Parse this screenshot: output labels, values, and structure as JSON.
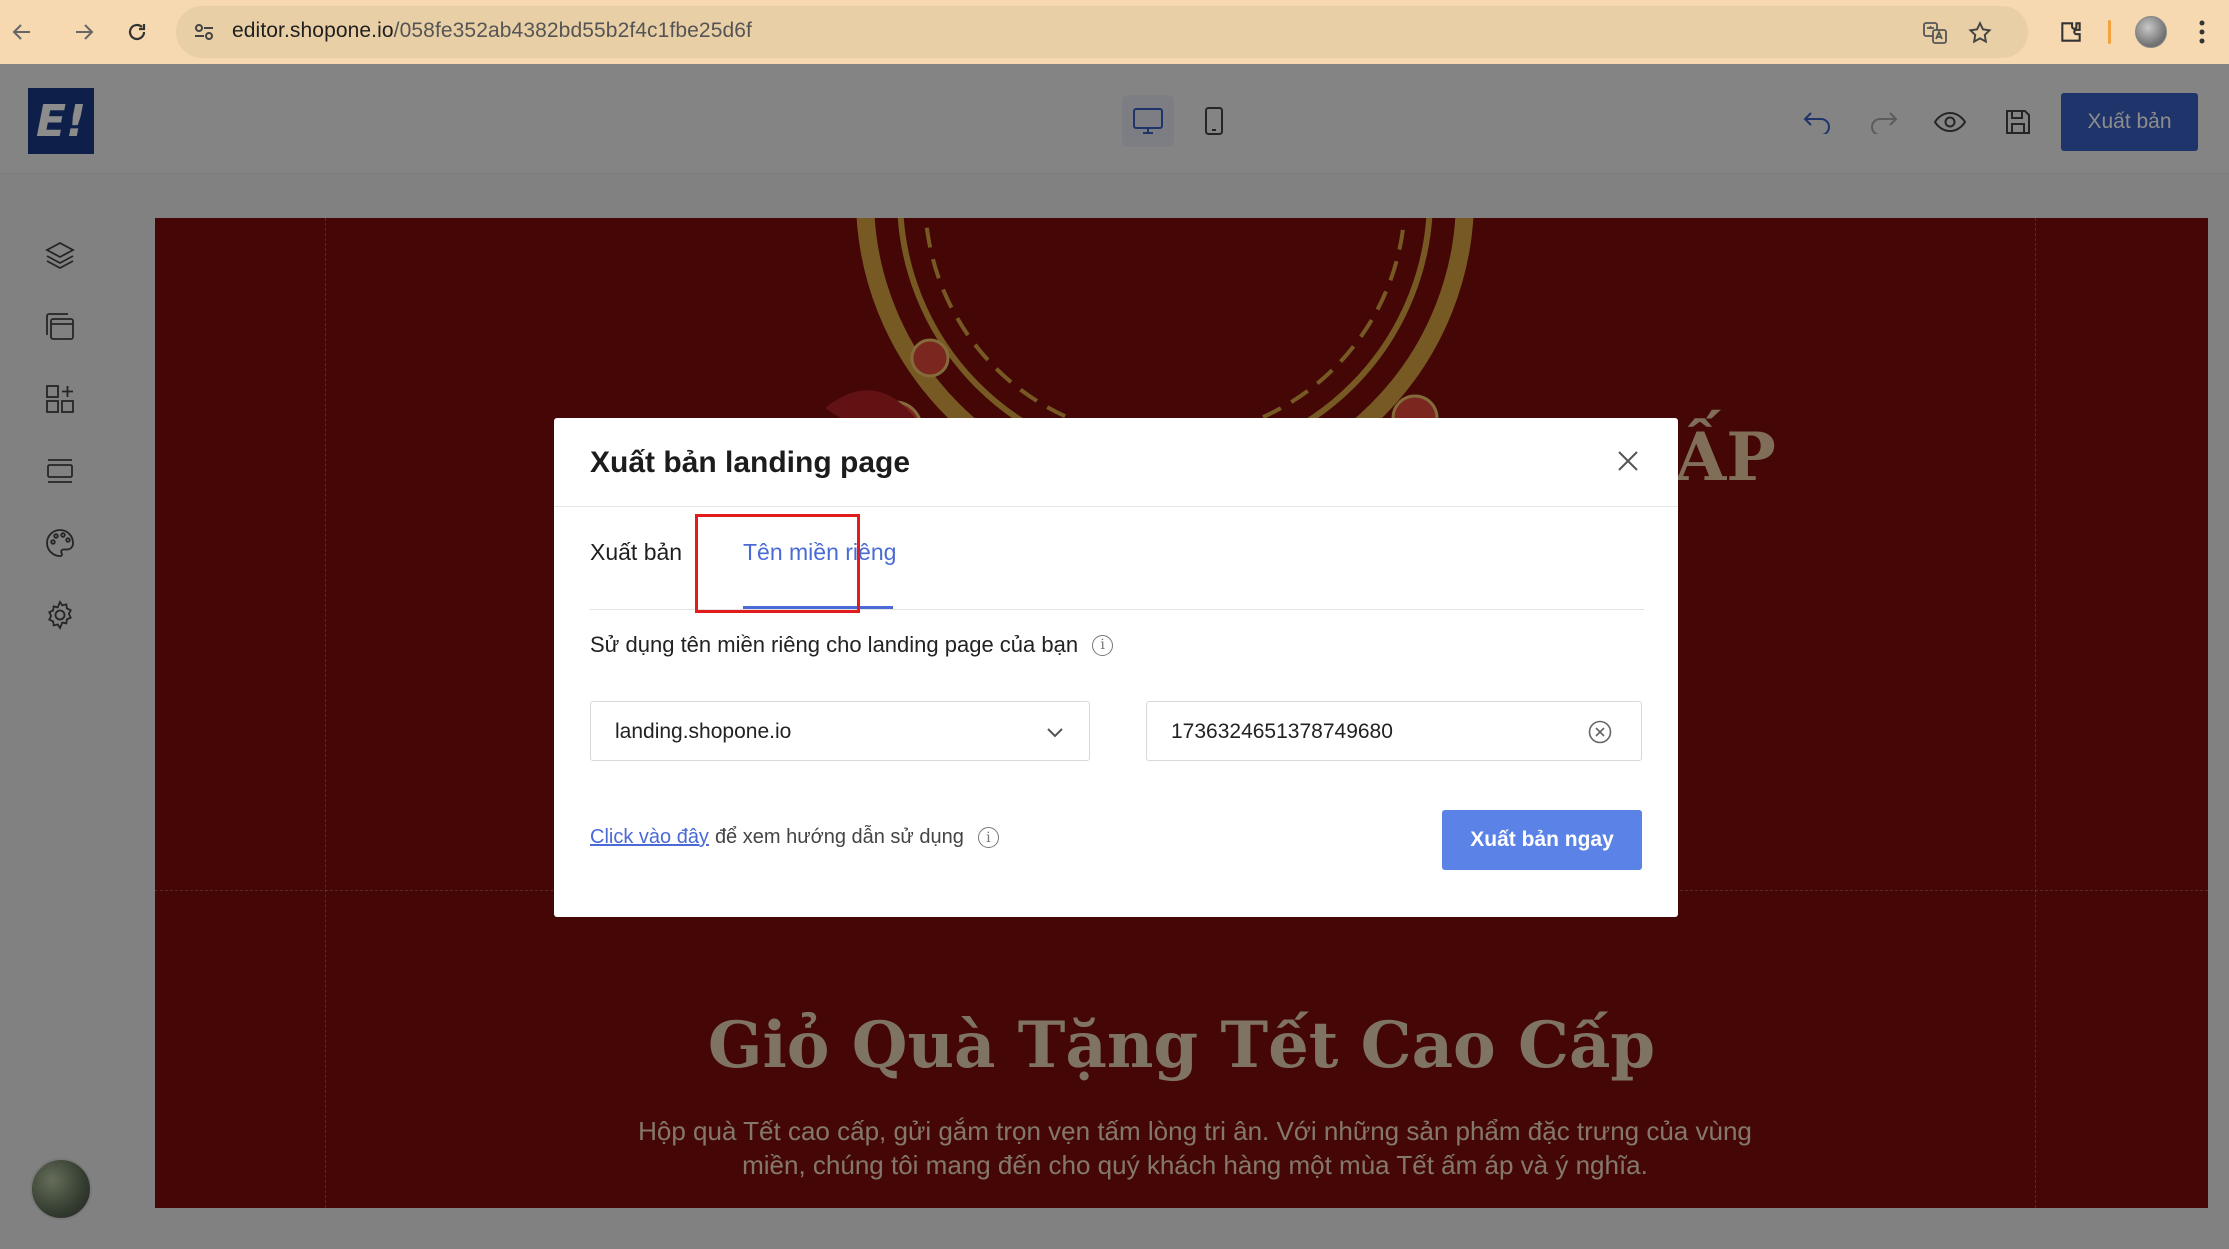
{
  "browser": {
    "url_host": "editor.shopone.io",
    "url_path": "/058fe352ab4382bd55b2f4c1fbe25d6f"
  },
  "editor": {
    "logo_text": "E!",
    "publish_label": "Xuất bản"
  },
  "canvas": {
    "hero_peek": "ẤP",
    "title": "Giỏ Quà Tặng Tết Cao Cấp",
    "description": "Hộp quà Tết cao cấp, gửi gắm trọn vẹn tấm lòng tri ân. Với những sản phẩm đặc trưng của vùng miền, chúng tôi mang đến cho quý khách hàng một mùa Tết ấm áp và ý nghĩa."
  },
  "modal": {
    "title": "Xuất bản landing page",
    "tabs": [
      {
        "label": "Xuất bản",
        "active": false
      },
      {
        "label": "Tên miền riêng",
        "active": true
      }
    ],
    "description": "Sử dụng tên miền riêng cho landing page của bạn",
    "domain_select": {
      "value": "landing.shopone.io"
    },
    "slug_input": {
      "value": "1736324651378749680"
    },
    "help_link": "Click vào đây",
    "help_text": "để xem hướng dẫn sử dụng",
    "publish_now_label": "Xuất bản ngay"
  },
  "colors": {
    "accent": "#4a6ad6",
    "primary_button": "#5b82e6",
    "highlight": "#e21c1c",
    "canvas_bg": "#7d0d0b"
  },
  "icons": [
    "back-arrow-icon",
    "forward-arrow-icon",
    "reload-icon",
    "site-info-icon",
    "translate-icon",
    "bookmark-star-icon",
    "extensions-icon",
    "kebab-menu-icon",
    "desktop-icon",
    "mobile-icon",
    "undo-icon",
    "redo-icon",
    "eye-icon",
    "save-icon",
    "layers-icon",
    "pages-icon",
    "add-elements-icon",
    "sections-icon",
    "palette-icon",
    "settings-icon",
    "close-icon",
    "chevron-down-icon",
    "clear-circle-icon",
    "info-icon"
  ]
}
